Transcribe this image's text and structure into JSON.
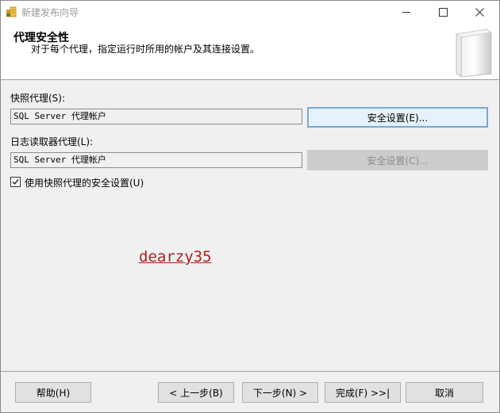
{
  "window": {
    "title": "新建发布向导",
    "min_glyph": "—",
    "max_glyph": "☐",
    "close_glyph": "✕"
  },
  "header": {
    "title": "代理安全性",
    "subtitle": "对于每个代理，指定运行时所用的帐户及其连接设置。"
  },
  "snapshot_agent": {
    "label": "快照代理(S):",
    "value": "SQL Server 代理帐户",
    "button_label": "安全设置(E)..."
  },
  "log_reader_agent": {
    "label": "日志读取器代理(L):",
    "value": "SQL Server 代理帐户",
    "button_label": "安全设置(C)..."
  },
  "use_snapshot_security": {
    "label": "使用快照代理的安全设置(U)",
    "checked": true
  },
  "watermark": "dearzy35",
  "footer": {
    "help_label": "帮助(H)",
    "back_label": "< 上一步(B)",
    "next_label": "下一步(N) >",
    "finish_label": "完成(F) >>|",
    "cancel_label": "取消"
  },
  "colors": {
    "accent_border": "#7aa7d4",
    "disabled_text": "#8c8c8c",
    "watermark": "#b11e1e"
  }
}
